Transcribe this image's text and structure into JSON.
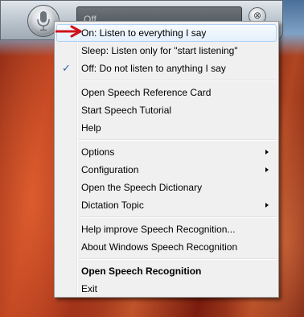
{
  "speech_bar": {
    "status_text": "Off",
    "close_glyph": "⊗"
  },
  "menu": {
    "items": [
      {
        "label": "On: Listen to everything I say",
        "highlighted": true
      },
      {
        "label": "Sleep: Listen only for \"start listening\""
      },
      {
        "label": "Off: Do not listen to anything I say",
        "checked": true
      },
      {
        "label": "Open Speech Reference Card"
      },
      {
        "label": "Start Speech Tutorial"
      },
      {
        "label": "Help"
      },
      {
        "label": "Options",
        "submenu": true
      },
      {
        "label": "Configuration",
        "submenu": true
      },
      {
        "label": "Open the Speech Dictionary"
      },
      {
        "label": "Dictation Topic",
        "submenu": true
      },
      {
        "label": "Help improve Speech Recognition..."
      },
      {
        "label": "About Windows Speech Recognition"
      },
      {
        "label": "Open Speech Recognition",
        "bold": true
      },
      {
        "label": "Exit"
      }
    ],
    "checkmark_glyph": "✓"
  },
  "colors": {
    "highlight_border": "#aecff7",
    "annotation_arrow": "#d0121a",
    "checkmark": "#2f5ea8"
  },
  "icons": [
    "microphone-icon",
    "close-icon",
    "checkmark-icon",
    "submenu-arrow-icon",
    "red-arrow-annotation"
  ]
}
